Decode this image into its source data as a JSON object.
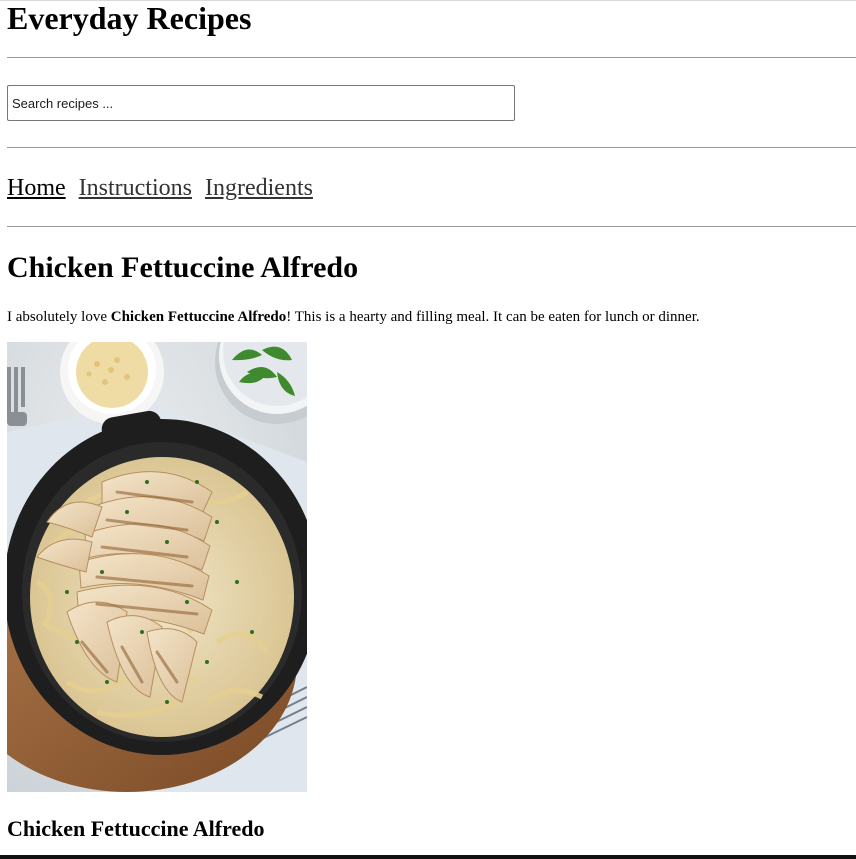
{
  "site": {
    "title": "Everyday Recipes"
  },
  "search": {
    "placeholder": "Search recipes ..."
  },
  "nav": {
    "items": [
      {
        "label": "Home"
      },
      {
        "label": "Instructions"
      },
      {
        "label": "Ingredients"
      }
    ]
  },
  "recipe": {
    "title": "Chicken Fettuccine Alfredo",
    "intro_before": "I absolutely love ",
    "intro_bold": "Chicken Fettuccine Alfredo",
    "intro_after": "! This is a hearty and filling meal. It can be eaten for lunch or dinner.",
    "image_alt": "Chicken Fettuccine Alfredo",
    "caption": "Chicken Fettuccine Alfredo"
  }
}
